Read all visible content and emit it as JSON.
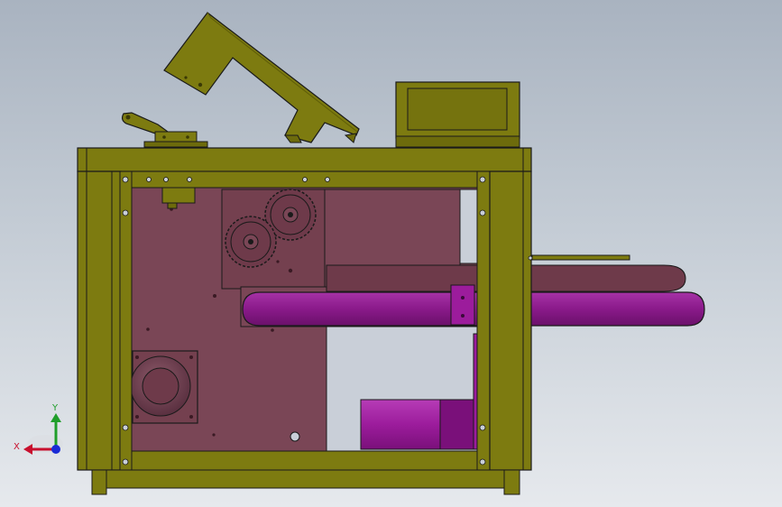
{
  "colors": {
    "frame": "#7d7b10",
    "frame_dark": "#5f5d08",
    "plate": "#7a4656",
    "plate_dark": "#5e3343",
    "belt": "#8a1a8a",
    "belt_dark": "#5e0f5e",
    "motor": "#9c1c9c",
    "outline": "#1a1a1a",
    "axis_x": "#c8102e",
    "axis_y": "#1f9e2a",
    "axis_origin": "#1a2bd6"
  },
  "triad": {
    "x_label": "X",
    "y_label": "Y"
  }
}
